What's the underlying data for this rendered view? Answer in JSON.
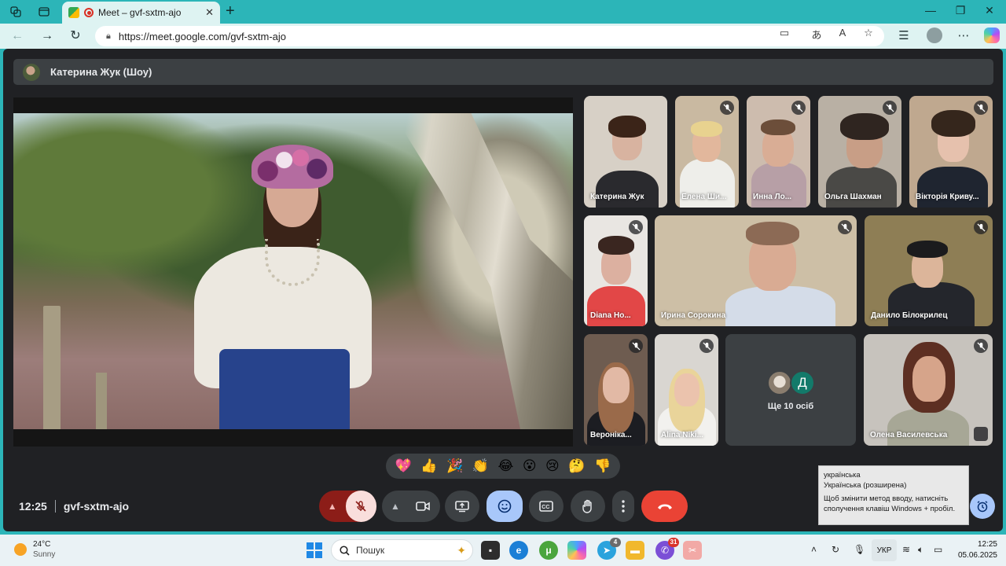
{
  "browser": {
    "tab_title": "Meet – gvf-sxtm-ajo",
    "url": "https://meet.google.com/gvf-sxtm-ajo"
  },
  "meet": {
    "presenter_label": "Катерина Жук (Шоу)",
    "tiles": [
      {
        "name": "Катерина Жук",
        "muted": false
      },
      {
        "name": "Елена Ши...",
        "muted": true
      },
      {
        "name": "Инна Ло...",
        "muted": true
      },
      {
        "name": "Ольга Шахман",
        "muted": true
      },
      {
        "name": "Вікторія Криву...",
        "muted": true
      },
      {
        "name": "Diana Ho...",
        "muted": true
      },
      {
        "name": "Ирина Сорокина",
        "muted": true
      },
      {
        "name": "Данило Білокрилец",
        "muted": true
      },
      {
        "name": "Вероніка...",
        "muted": true
      },
      {
        "name": "Alina Niki...",
        "muted": true
      },
      {
        "name": "Олена Василевська",
        "muted": true
      }
    ],
    "more_avatar_letter": "Д",
    "more_label": "Ще 10 осіб",
    "reactions": [
      "💖",
      "👍",
      "🎉",
      "👏",
      "😂",
      "😮",
      "😢",
      "🤔",
      "👎"
    ],
    "time": "12:25",
    "meeting_code": "gvf-sxtm-ajo"
  },
  "ime_tooltip": {
    "line1": "українська",
    "line2": "Українська (розширена)",
    "line3": "Щоб змінити метод вводу, натисніть сполучення клавіш Windows + пробіл."
  },
  "taskbar": {
    "weather_temp": "24°C",
    "weather_desc": "Sunny",
    "search_placeholder": "Пошук",
    "telegram_badge": "4",
    "viber_badge": "31",
    "language": "УКР",
    "time": "12:25",
    "date": "05.06.2025"
  },
  "colors": {
    "accent": "#2cb5b8",
    "meet_bg": "#202124",
    "tile_bg": "#3c4043",
    "end_call": "#ea4335",
    "mic_off": "#8c1d18",
    "emoji_btn": "#a8c7fa"
  }
}
